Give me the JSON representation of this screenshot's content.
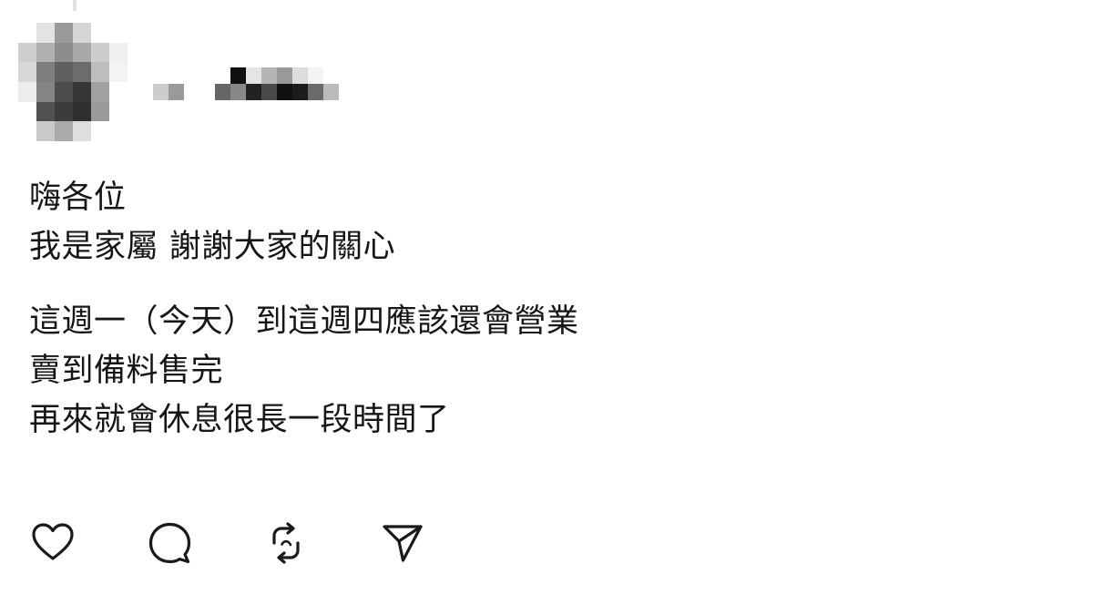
{
  "post": {
    "lines_para1": [
      "嗨各位",
      "我是家屬 謝謝大家的關心"
    ],
    "lines_para2": [
      "這週一（今天）到這週四應該還會營業",
      "賣到備料售完",
      "再來就會休息很長一段時間了"
    ]
  },
  "actions": [
    {
      "icon": "heart-icon",
      "name": "like"
    },
    {
      "icon": "comment-icon",
      "name": "reply"
    },
    {
      "icon": "repost-icon",
      "name": "repost"
    },
    {
      "icon": "send-icon",
      "name": "share"
    }
  ],
  "colors": {
    "text": "#161616",
    "icon": "#1a1a1a",
    "background": "#ffffff"
  }
}
